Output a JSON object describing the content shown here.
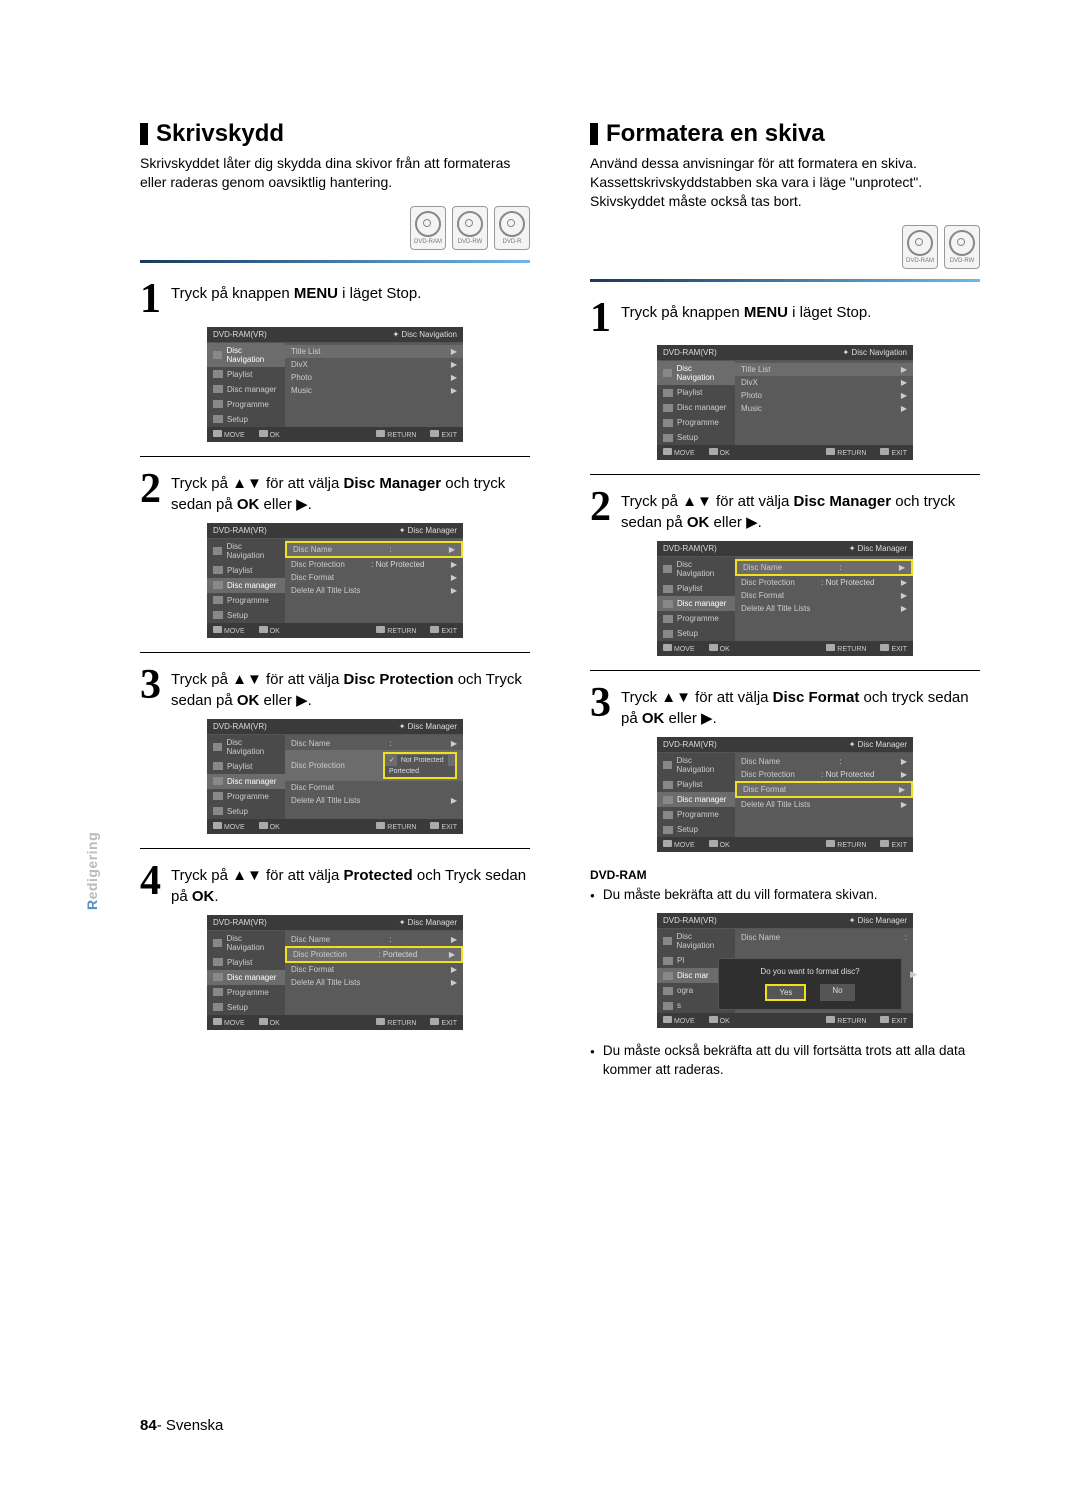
{
  "sidebar_label_prefix": "R",
  "sidebar_label_rest": "edigering",
  "footer_page": "84",
  "footer_sep": "- ",
  "footer_lang": "Svenska",
  "disc_labels": {
    "ram": "DVD-RAM",
    "rw": "DVD-RW",
    "r": "DVD-R"
  },
  "left": {
    "heading": "Skrivskydd",
    "intro": "Skrivskyddet låter dig skydda dina skivor från att formateras eller raderas genom oavsiktlig hantering.",
    "step1": {
      "pre": "Tryck på knappen ",
      "bold": "MENU",
      "post": " i läget Stop."
    },
    "step2": {
      "pre": "Tryck på ▲▼ för att välja ",
      "bold": "Disc Manager",
      "post": " och tryck sedan på ",
      "bold2": "OK",
      "post2": " eller ▶."
    },
    "step3": {
      "pre": "Tryck på  ▲▼ för att välja ",
      "bold": "Disc Protection",
      "post": " och Tryck sedan på ",
      "bold2": "OK",
      "post2": " eller ▶."
    },
    "step4": {
      "pre": "Tryck på  ▲▼ för att välja ",
      "bold": "Protected",
      "post": " och Tryck sedan på ",
      "bold2": "OK",
      "post2": "."
    }
  },
  "right": {
    "heading": "Formatera en skiva",
    "intro": "Använd dessa anvisningar för att formatera en skiva. Kassettskrivskyddstabben ska vara i läge \"unprotect\". Skivskyddet måste också tas bort.",
    "step1": {
      "pre": "Tryck på knappen ",
      "bold": "MENU",
      "post": " i läget Stop."
    },
    "step2": {
      "pre": "Tryck på ▲▼ för att välja ",
      "bold": "Disc Manager",
      "post": " och tryck sedan på ",
      "bold2": "OK",
      "post2": " eller ▶."
    },
    "step3": {
      "pre": "Tryck ▲▼ för att välja ",
      "bold": "Disc Format",
      "post": " och tryck sedan på ",
      "bold2": "OK",
      "post2": " eller ▶."
    },
    "sub": "DVD-RAM",
    "bullet1": "Du måste bekräfta att du vill formatera skivan.",
    "bullet2": "Du måste också bekräfta att du vill fortsätta trots att alla data kommer att raderas."
  },
  "osd": {
    "title": "DVD-RAM(VR)",
    "crumb_nav": "Disc Navigation",
    "crumb_mgr": "Disc Manager",
    "side": [
      "Disc Navigation",
      "Playlist",
      "Disc manager",
      "Programme",
      "Setup"
    ],
    "nav_items": [
      "Title List",
      "DivX",
      "Photo",
      "Music"
    ],
    "mgr_items": {
      "name": "Disc Name",
      "name_val": ":",
      "prot": "Disc Protection",
      "prot_np": ": Not Protected",
      "prot_p": ": Portected",
      "fmt": "Disc Format",
      "del": "Delete All Title Lists"
    },
    "opts": {
      "np": "Not Protected",
      "p": "Portected"
    },
    "dialog": "Do you want to format disc?",
    "yes": "Yes",
    "no": "No",
    "bottom": {
      "move": "MOVE",
      "ok": "OK",
      "ret": "RETURN",
      "exit": "EXIT"
    }
  }
}
